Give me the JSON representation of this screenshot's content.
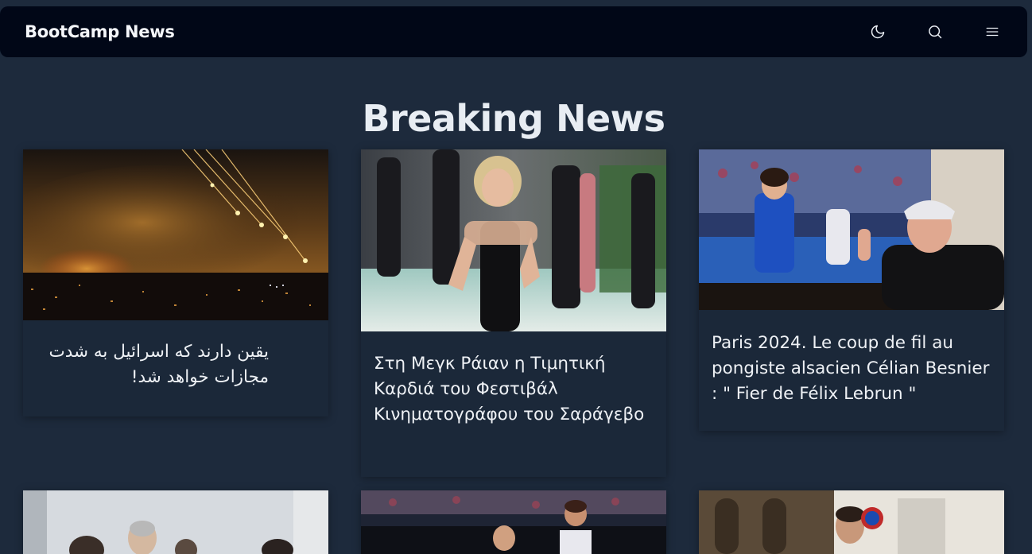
{
  "header": {
    "brand": "BootCamp News",
    "icons": [
      "moon-icon",
      "search-icon",
      "menu-icon"
    ]
  },
  "page": {
    "title": "Breaking News"
  },
  "articles": [
    {
      "caption": "یقین دارند که اسرائیل به شدت مجازات خواهد شد!",
      "image": "night-city-rockets-photo"
    },
    {
      "caption": "Στη Μεγκ Ράιαν η Τιμητική Καρδιά του Φεστιβάλ Κινηματογράφου του Σαράγεβο",
      "image": "red-carpet-actress-photo"
    },
    {
      "caption": "Paris 2024. Le coup de fil au pongiste alsacien Célian Besnier : \" Fier de Félix Lebrun \"",
      "image": "table-tennis-tv-fan-photo"
    },
    {
      "caption": "",
      "image": "group-people-photo"
    },
    {
      "caption": "",
      "image": "basketball-game-photo"
    },
    {
      "caption": "",
      "image": "street-scene-photo"
    }
  ],
  "colors": {
    "background": "#1d2a3c",
    "navbar": "#010717",
    "card": "#1b2839",
    "text": "#eef1f5"
  }
}
